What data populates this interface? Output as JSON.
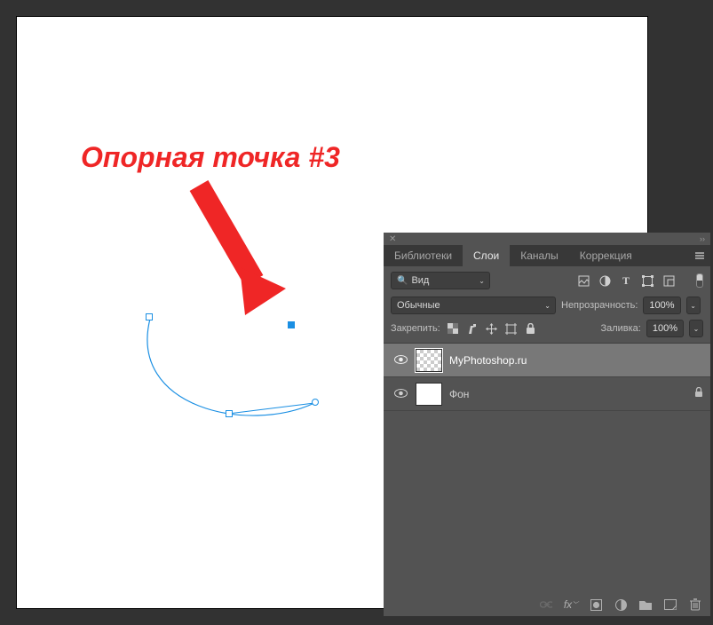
{
  "annotation": {
    "title": "Опорная точка #3"
  },
  "panel": {
    "tabs": [
      "Библиотеки",
      "Слои",
      "Каналы",
      "Коррекция"
    ],
    "active_tab_index": 1,
    "filter": {
      "kind_label": "Вид"
    },
    "blend": {
      "mode": "Обычные",
      "opacity_label": "Непрозрачность:",
      "opacity_value": "100%"
    },
    "lock": {
      "label": "Закрепить:",
      "fill_label": "Заливка:",
      "fill_value": "100%"
    },
    "layers": [
      {
        "name": "MyPhotoshop.ru",
        "thumb": "transparent",
        "selected": true,
        "locked": false
      },
      {
        "name": "Фон",
        "thumb": "white",
        "selected": false,
        "locked": true
      }
    ]
  }
}
